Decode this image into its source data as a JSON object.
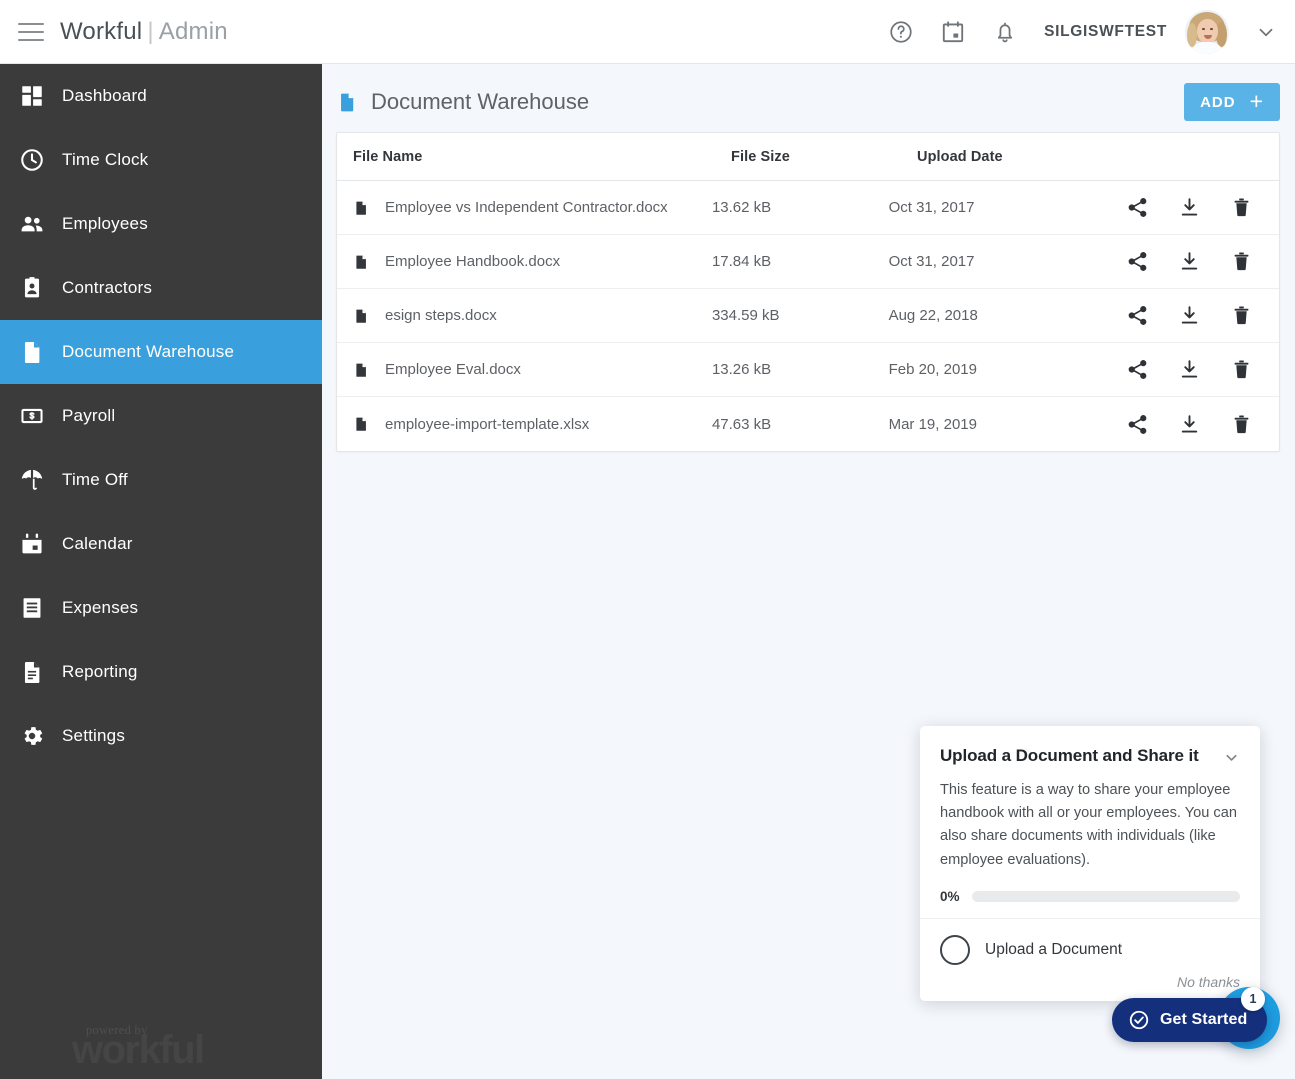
{
  "topbar": {
    "menu_icon": "hamburger-menu-icon",
    "brand": "Workful",
    "brand_separator": "|",
    "brand_suffix": "Admin",
    "help_icon": "help-circle-icon",
    "calendar_icon": "calendar-icon",
    "notifications_icon": "bell-icon",
    "username": "SILGISWFTEST",
    "avatar_icon": "user-avatar-photo",
    "account_chevron_icon": "chevron-down-icon"
  },
  "sidebar": {
    "active_color": "#3aa0dd",
    "background": "#3b3b3b",
    "items": [
      {
        "label": "Dashboard",
        "icon": "dashboard-grid-icon",
        "active": false
      },
      {
        "label": "Time Clock",
        "icon": "clock-icon",
        "active": false
      },
      {
        "label": "Employees",
        "icon": "people-icon",
        "active": false
      },
      {
        "label": "Contractors",
        "icon": "id-badge-icon",
        "active": false
      },
      {
        "label": "Document Warehouse",
        "icon": "document-icon",
        "active": true
      },
      {
        "label": "Payroll",
        "icon": "money-bill-icon",
        "active": false
      },
      {
        "label": "Time Off",
        "icon": "umbrella-icon",
        "active": false
      },
      {
        "label": "Calendar",
        "icon": "calendar-icon",
        "active": false
      },
      {
        "label": "Expenses",
        "icon": "receipt-icon",
        "active": false
      },
      {
        "label": "Reporting",
        "icon": "report-document-icon",
        "active": false
      },
      {
        "label": "Settings",
        "icon": "gear-icon",
        "active": false
      }
    ],
    "footer": {
      "powered_by": "powered by",
      "wordmark": "workful"
    }
  },
  "page": {
    "title": "Document Warehouse",
    "title_icon": "document-icon",
    "add_button": {
      "label": "ADD",
      "plus_icon": "plus-icon",
      "color": "#5ab3e6"
    }
  },
  "table": {
    "columns": [
      "File Name",
      "File Size",
      "Upload Date"
    ],
    "row_icon": "file-document-icon",
    "actions": [
      {
        "name": "share-icon",
        "label": "Share"
      },
      {
        "name": "download-icon",
        "label": "Download"
      },
      {
        "name": "trash-icon",
        "label": "Delete"
      }
    ],
    "rows": [
      {
        "name": "Employee vs Independent Contractor.docx",
        "size": "13.62 kB",
        "date": "Oct 31, 2017"
      },
      {
        "name": "Employee Handbook.docx",
        "size": "17.84 kB",
        "date": "Oct 31, 2017"
      },
      {
        "name": "esign steps.docx",
        "size": "334.59 kB",
        "date": "Aug 22, 2018"
      },
      {
        "name": "Employee Eval.docx",
        "size": "13.26 kB",
        "date": "Feb 20, 2019"
      },
      {
        "name": "employee-import-template.xlsx",
        "size": "47.63 kB",
        "date": "Mar 19, 2019"
      }
    ]
  },
  "popup": {
    "title": "Upload a Document and Share it",
    "collapse_icon": "chevron-down-icon",
    "body": "This feature is a way to share your employee handbook with all or your employees. You can also share documents with individuals (like employee evaluations).",
    "progress_label": "0%",
    "progress_value": 0,
    "step_label": "Upload a Document",
    "step_radio_icon": "radio-unchecked-icon",
    "dismiss_label": "No thanks"
  },
  "widgets": {
    "get_started": {
      "label": "Get Started",
      "icon": "check-circle-icon",
      "badge": "1",
      "color": "#14307c"
    },
    "chat_launcher": {
      "icon": "chat-bubble-icon",
      "color": "#1e9ce0"
    }
  }
}
